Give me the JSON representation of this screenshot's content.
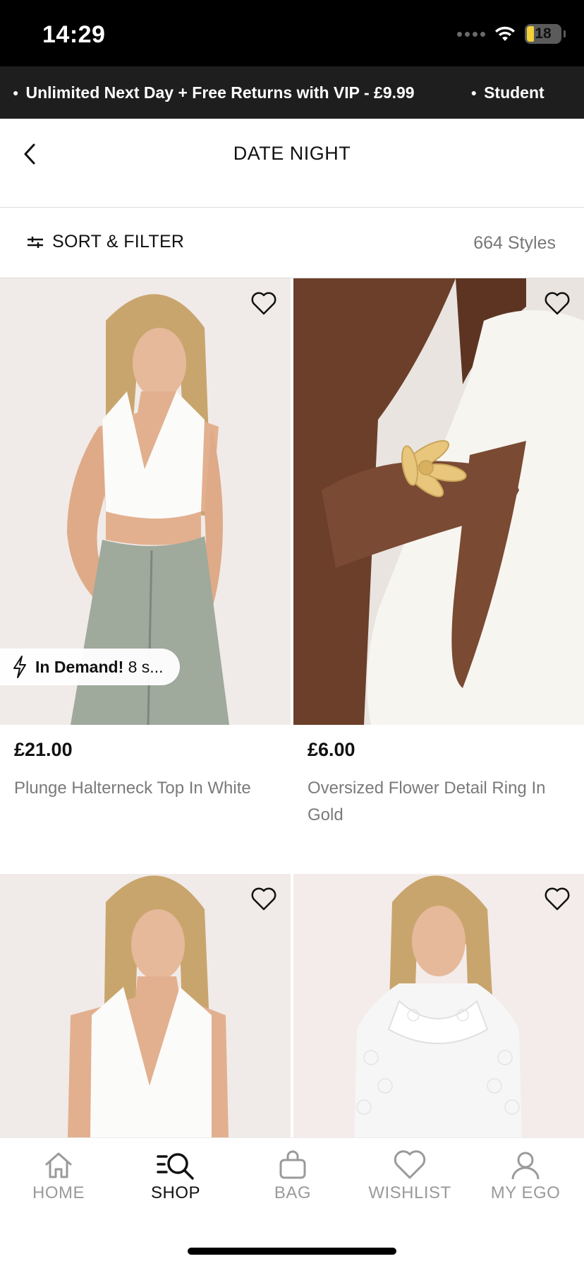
{
  "status_bar": {
    "time": "14:29",
    "battery": "18"
  },
  "promo": {
    "items": [
      "Unlimited Next Day + Free Returns with VIP - £9.99",
      "Student"
    ]
  },
  "header": {
    "title": "DATE NIGHT"
  },
  "filter_bar": {
    "label": "SORT & FILTER",
    "count": "664 Styles"
  },
  "products": [
    {
      "price": "£21.00",
      "name": "Plunge Halterneck Top In White",
      "badge_strong": "In Demand!",
      "badge_text": "8 s..."
    },
    {
      "price": "£6.00",
      "name": "Oversized Flower Detail Ring In Gold"
    }
  ],
  "bottom_nav": {
    "items": [
      {
        "label": "HOME",
        "icon": "home-icon"
      },
      {
        "label": "SHOP",
        "icon": "shop-search-icon"
      },
      {
        "label": "BAG",
        "icon": "bag-icon"
      },
      {
        "label": "WISHLIST",
        "icon": "heart-icon"
      },
      {
        "label": "MY EGO",
        "icon": "user-icon"
      }
    ],
    "active": "SHOP"
  },
  "colors": {
    "accent": "#111111",
    "inactive": "#9a9a9a",
    "promo_bg": "#1e1e1e"
  }
}
